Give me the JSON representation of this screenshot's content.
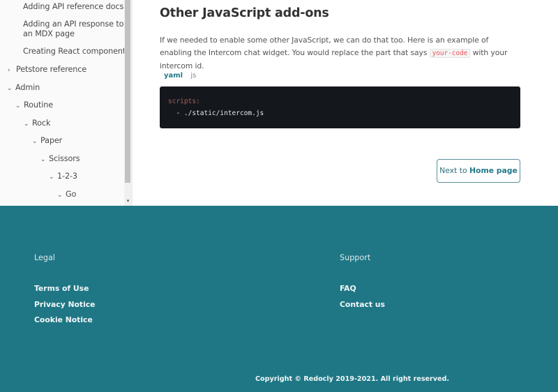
{
  "sidebar": {
    "items": [
      {
        "label": "Adding API reference docs",
        "chevron": ""
      },
      {
        "label": "Adding an API response to",
        "chevron": ""
      },
      {
        "label": "an MDX page",
        "chevron": ""
      },
      {
        "label": "Creating React components",
        "chevron": ""
      },
      {
        "label": "Petstore reference",
        "chevron": "›"
      },
      {
        "label": "Admin",
        "chevron": "⌄"
      },
      {
        "label": "Routine",
        "chevron": "⌄"
      },
      {
        "label": "Rock",
        "chevron": "⌄"
      },
      {
        "label": "Paper",
        "chevron": "⌄"
      },
      {
        "label": "Scissors",
        "chevron": "⌄"
      },
      {
        "label": "1-2-3",
        "chevron": "⌄"
      },
      {
        "label": "Go",
        "chevron": "⌄"
      }
    ],
    "scroll_down_glyph": "▾"
  },
  "main": {
    "heading": "Other JavaScript add-ons",
    "paragraph_before": "If we needed to enable some other JavaScript, we can do that too. Here is an example of enabling the Intercom chat widget. You would replace the part that says ",
    "inline_code": "your-code",
    "paragraph_after": " with your intercom id.",
    "tabs": [
      {
        "label": "yaml",
        "active": true
      },
      {
        "label": "js",
        "active": false
      }
    ],
    "code": {
      "line1": "scripts:",
      "line2": "  - ./static/intercom.js"
    },
    "next_button": {
      "prefix": "Next to ",
      "target": "Home page"
    }
  },
  "footer": {
    "legal": {
      "title": "Legal",
      "links": [
        "Terms of Use",
        "Privacy Notice",
        "Cookie Notice"
      ]
    },
    "support": {
      "title": "Support",
      "links": [
        "FAQ",
        "Contact us"
      ]
    },
    "copyright": "Copyright © Redocly 2019-2021. All right reserved."
  },
  "colors": {
    "accent": "#227989",
    "footer_bg": "#1f7785",
    "code_bg": "#14181d"
  }
}
